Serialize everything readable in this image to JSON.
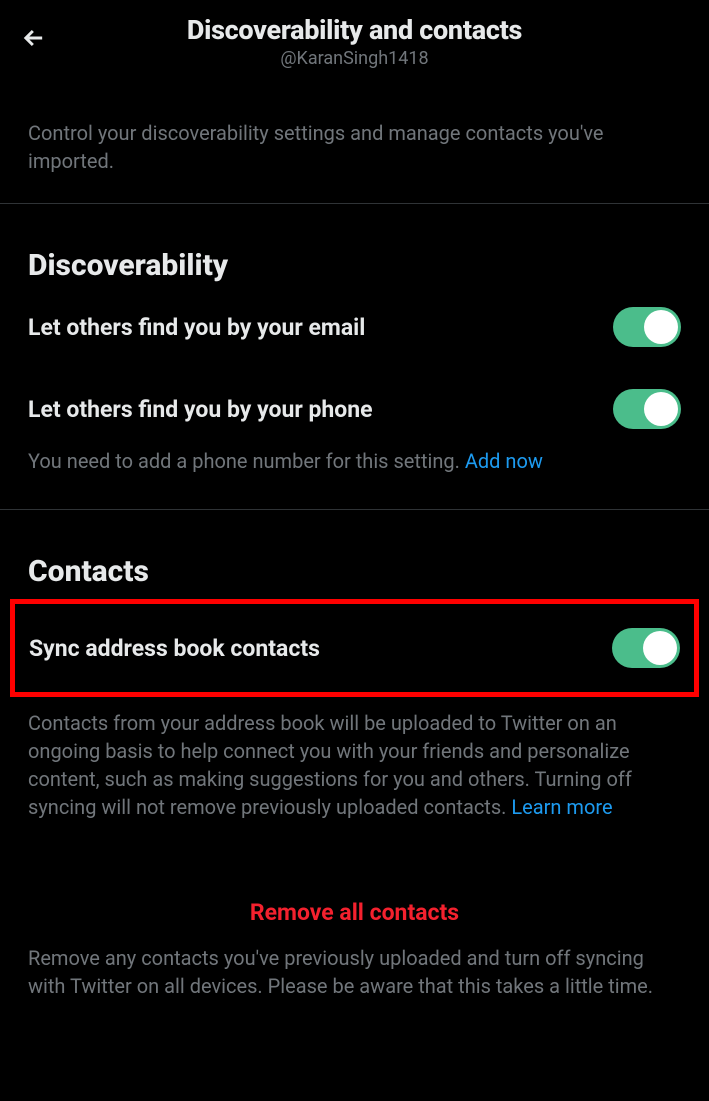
{
  "header": {
    "title": "Discoverability and contacts",
    "subtitle": "@KaranSingh1418"
  },
  "description": "Control your discoverability settings and manage contacts you've imported.",
  "discoverability": {
    "section_title": "Discoverability",
    "email_label": "Let others find you by your email",
    "phone_label": "Let others find you by your phone",
    "phone_helper": "You need to add a phone number for this setting. ",
    "add_now": "Add now"
  },
  "contacts": {
    "section_title": "Contacts",
    "sync_label": "Sync address book contacts",
    "sync_helper": "Contacts from your address book will be uploaded to Twitter on an ongoing basis to help connect you with your friends and personalize content, such as making suggestions for you and others. Turning off syncing will not remove previously uploaded contacts. ",
    "learn_more": "Learn more",
    "remove_button": "Remove all contacts",
    "remove_helper": "Remove any contacts you've previously uploaded and turn off syncing with Twitter on all devices. Please be aware that this takes a little time."
  }
}
